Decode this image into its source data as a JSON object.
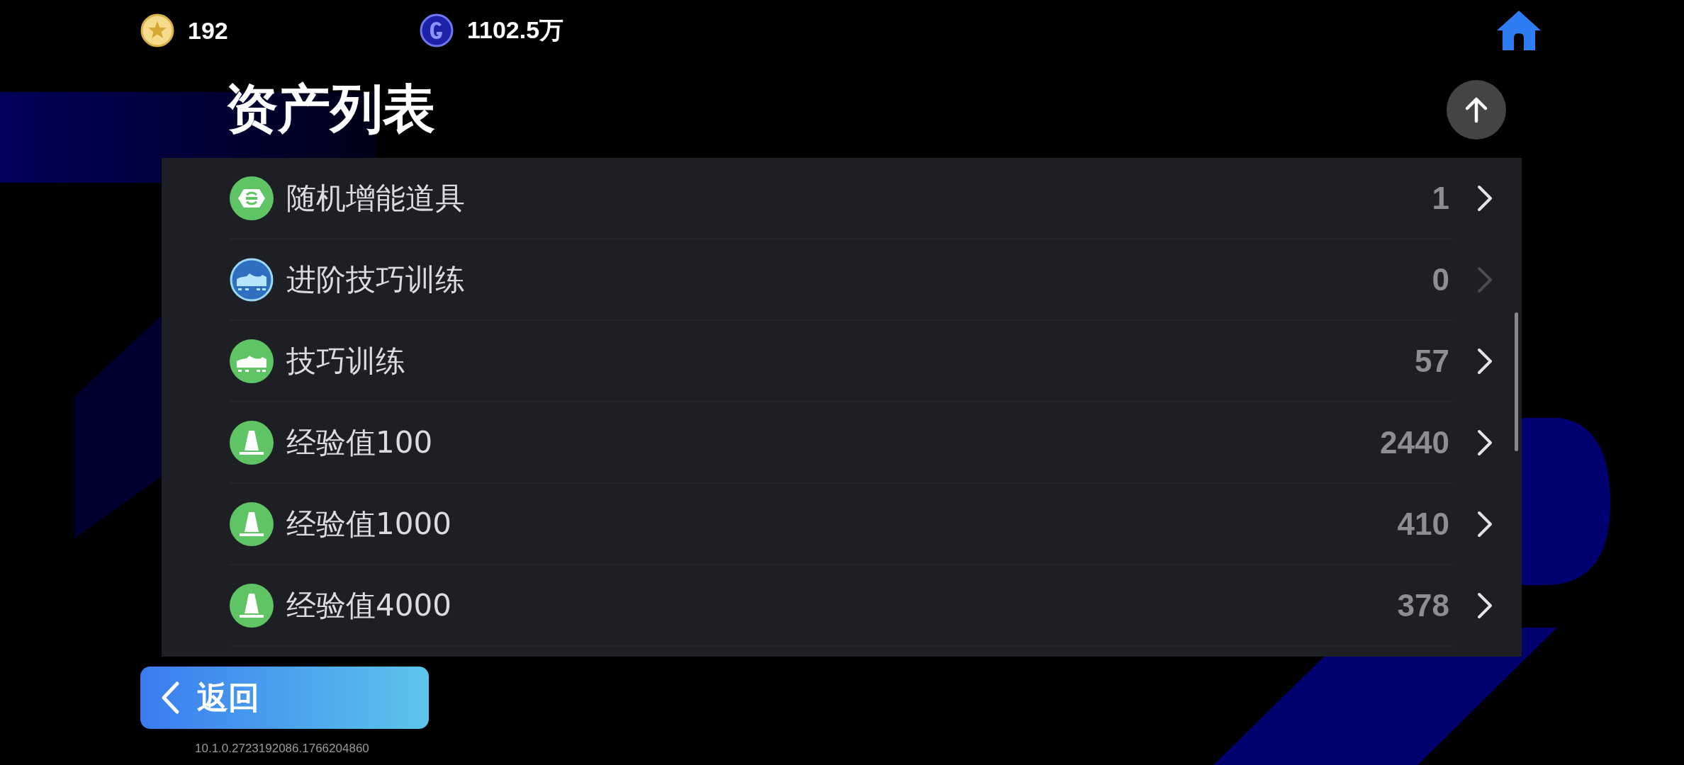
{
  "currencies": [
    {
      "kind": "star",
      "amount": "192"
    },
    {
      "kind": "g",
      "amount": "1102.5万"
    }
  ],
  "title": "资产列表",
  "assets": [
    {
      "kind": "boost",
      "name": "随机增能道具",
      "count": "1",
      "disabled": false
    },
    {
      "kind": "advanced",
      "name": "进阶技巧训练",
      "count": "0",
      "disabled": true
    },
    {
      "kind": "training",
      "name": "技巧训练",
      "count": "57",
      "disabled": false
    },
    {
      "kind": "exp",
      "name": "经验值100",
      "count": "2440",
      "disabled": false
    },
    {
      "kind": "exp",
      "name": "经验值1000",
      "count": "410",
      "disabled": false
    },
    {
      "kind": "exp",
      "name": "经验值4000",
      "count": "378",
      "disabled": false
    }
  ],
  "back_button": {
    "label": "返回"
  },
  "version": "10.1.0.2723192086.1766204860"
}
